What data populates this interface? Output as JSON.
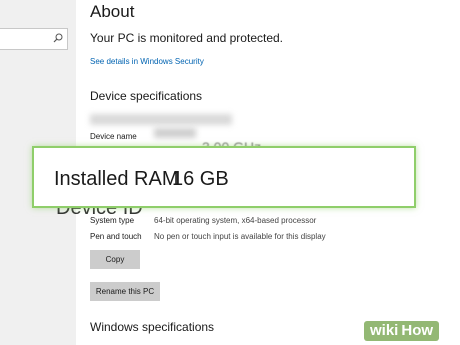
{
  "search": {
    "placeholder": ""
  },
  "about": {
    "title": "About",
    "protection_status": "Your PC is monitored and protected.",
    "security_link": "See details in Windows Security"
  },
  "device_specs": {
    "heading": "Device specifications",
    "device_name_label": "Device name",
    "partial_processor_value": "3.00 GHz",
    "partial_device_id_label": "Device ID",
    "rows": [
      {
        "label": "System type",
        "value": "64-bit operating system, x64-based processor"
      },
      {
        "label": "Pen and touch",
        "value": "No pen or touch input is available for this display"
      }
    ],
    "copy_button": "Copy",
    "rename_button": "Rename this PC"
  },
  "callout": {
    "label": "Installed RAM",
    "value": "16 GB"
  },
  "windows_specs": {
    "heading": "Windows specifications"
  },
  "watermark": {
    "part1": "wiki",
    "part2": "How"
  }
}
